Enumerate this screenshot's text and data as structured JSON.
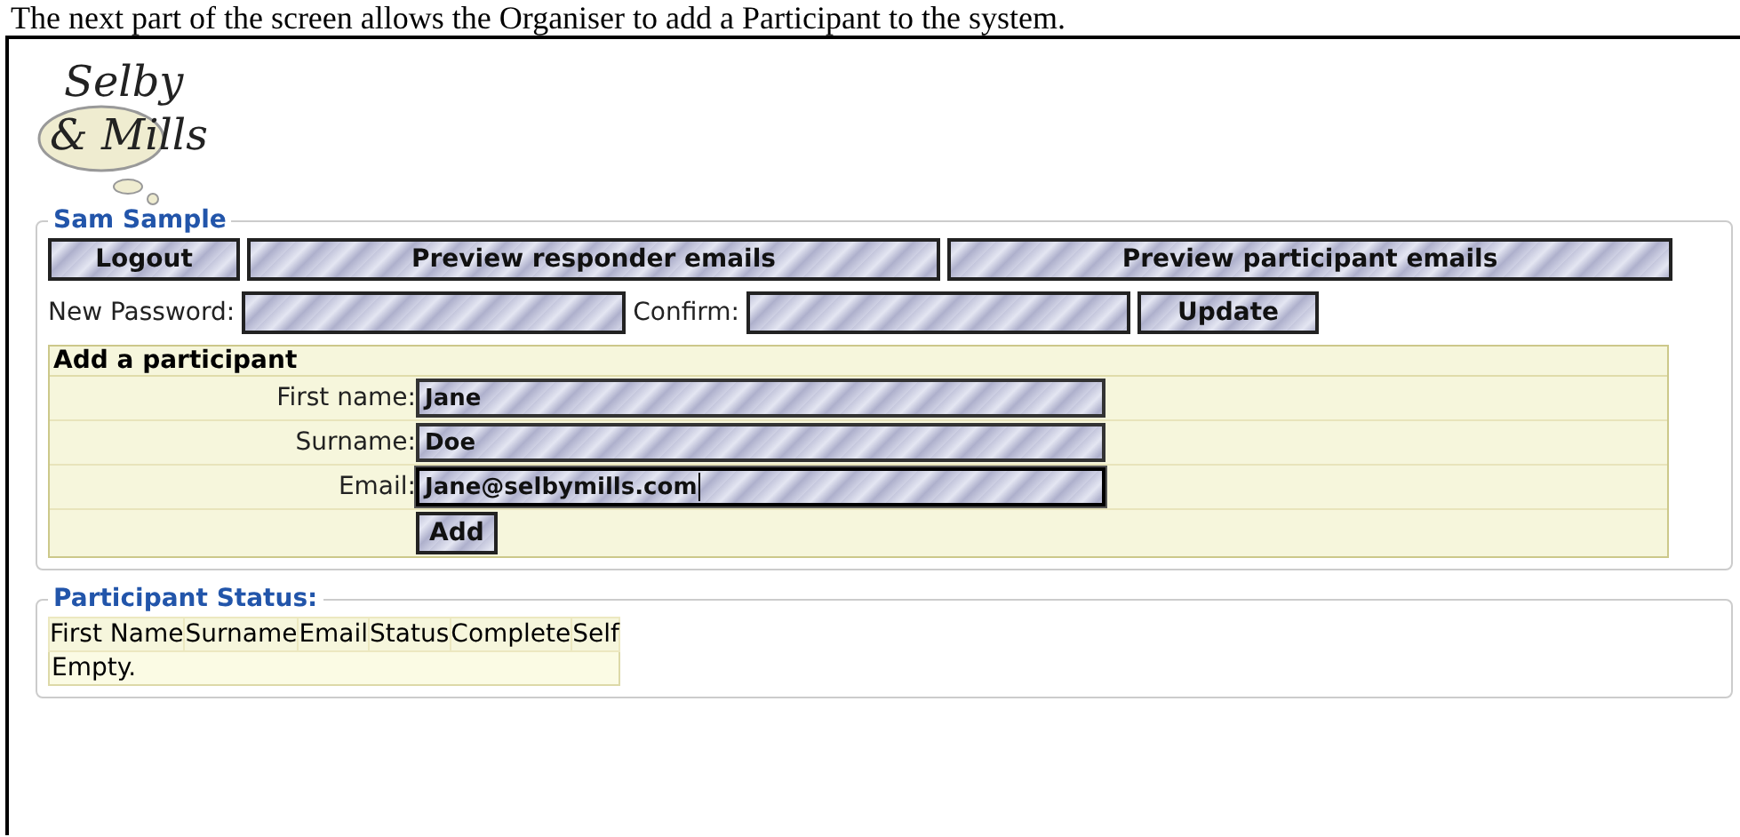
{
  "caption": "The next part of the screen allows the Organiser to add a Participant to the system.",
  "logo": {
    "line_1": "Selby",
    "line_2": "& Mills"
  },
  "account": {
    "legend": "Sam Sample",
    "buttons": [
      "Logout",
      "Preview responder emails",
      "Preview participant emails"
    ],
    "password_label": "New Password:",
    "confirm_label": "Confirm:",
    "update_button": "Update"
  },
  "add_participant": {
    "title": "Add a participant",
    "fields": [
      {
        "label": "First name:",
        "value": "Jane",
        "focused": false
      },
      {
        "label": "Surname:",
        "value": "Doe",
        "focused": false
      },
      {
        "label": "Email:",
        "value": "Jane@selbymills.com",
        "focused": true
      }
    ],
    "button": "Add"
  },
  "participant_status": {
    "legend": "Participant Status:",
    "columns": [
      "First Name",
      "Surname",
      "Email",
      "Status",
      "Complete",
      "Self"
    ],
    "empty_message": "Empty."
  }
}
